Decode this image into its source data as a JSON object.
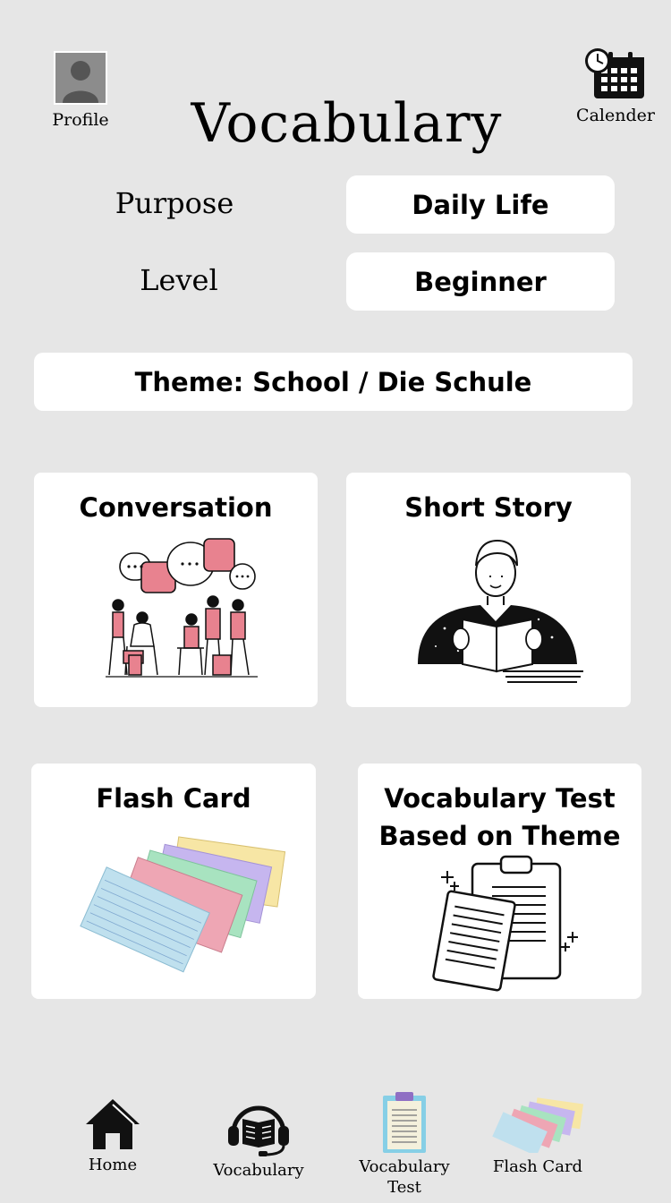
{
  "header": {
    "title": "Vocabulary",
    "profile_label": "Profile",
    "calendar_label": "Calender"
  },
  "settings": {
    "purpose_label": "Purpose",
    "purpose_value": "Daily Life",
    "level_label": "Level",
    "level_value": "Beginner"
  },
  "theme": {
    "label": "Theme: School / Die Schule"
  },
  "cards": {
    "conversation": "Conversation",
    "short_story": "Short Story",
    "flash_card": "Flash Card",
    "vocab_test_line1": "Vocabulary Test",
    "vocab_test_line2": "Based on Theme"
  },
  "bottom_nav": {
    "home": "Home",
    "vocabulary": "Vocabulary",
    "vocab_test_line1": "Vocabulary",
    "vocab_test_line2": "Test",
    "flash_card": "Flash Card"
  },
  "colors": {
    "background": "#e6e6e6",
    "card": "#ffffff",
    "accent_pink": "#e8828f"
  }
}
